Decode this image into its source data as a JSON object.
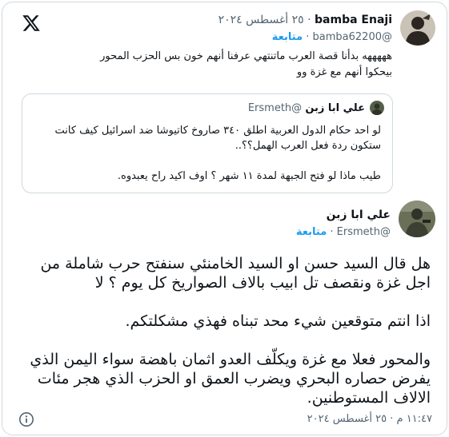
{
  "reply_tweet": {
    "name": "bamba Enaji",
    "date": "٢٥ أغسطس ٢٠٢٤",
    "handle": "@bamba62200",
    "follow_label": "متابعة",
    "text": "هههههه بدأنا قصة العرب ماتنتهي عرفنا أنهم خون بس الحزب المحور بيحكوا أنهم مع غزة وو"
  },
  "quoted_tweet": {
    "name": "علي ابا زبن",
    "handle": "@Ersmeth",
    "line1": "لو احد حكام الدول العربية اطلق ٣٤٠ صاروخ كاتيوشا ضد اسرائيل كيف كانت ستكون ردة فعل العرب الهمل؟؟..",
    "line2": "طيب ماذا لو فتح الجبهة لمدة ١١ شهر ؟ اوف اكيد راح يعبدوه."
  },
  "main_tweet": {
    "name": "علي ابا زبن",
    "handle": "@Ersmeth",
    "follow_label": "متابعة",
    "paragraph1": "هل قال السيد حسن او السيد الخامنئي سنفتح حرب شاملة من اجل غزة ونقصف تل ابيب بالاف الصواريخ كل يوم ؟ لا",
    "paragraph2": "اذا انتم متوقعين شيء محد تبناه فهذي مشكلتكم.",
    "paragraph3": "والمحور فعلا مع غزة ويكلّف العدو اثمان باهضة سواء اليمن الذي يفرض حصاره البحري ويضرب العمق او الحزب الذي هجر مئات الالاف المستوطنين.",
    "time": "١١:٤٧ م",
    "date": "٢٥ أغسطس ٢٠٢٤",
    "separator": "·"
  },
  "icons": {
    "brand": "x-logo-icon",
    "info": "info-icon"
  },
  "colors": {
    "accent": "#1d9bf0",
    "text": "#0f1419",
    "muted": "#536471",
    "border": "#cfd9de"
  }
}
